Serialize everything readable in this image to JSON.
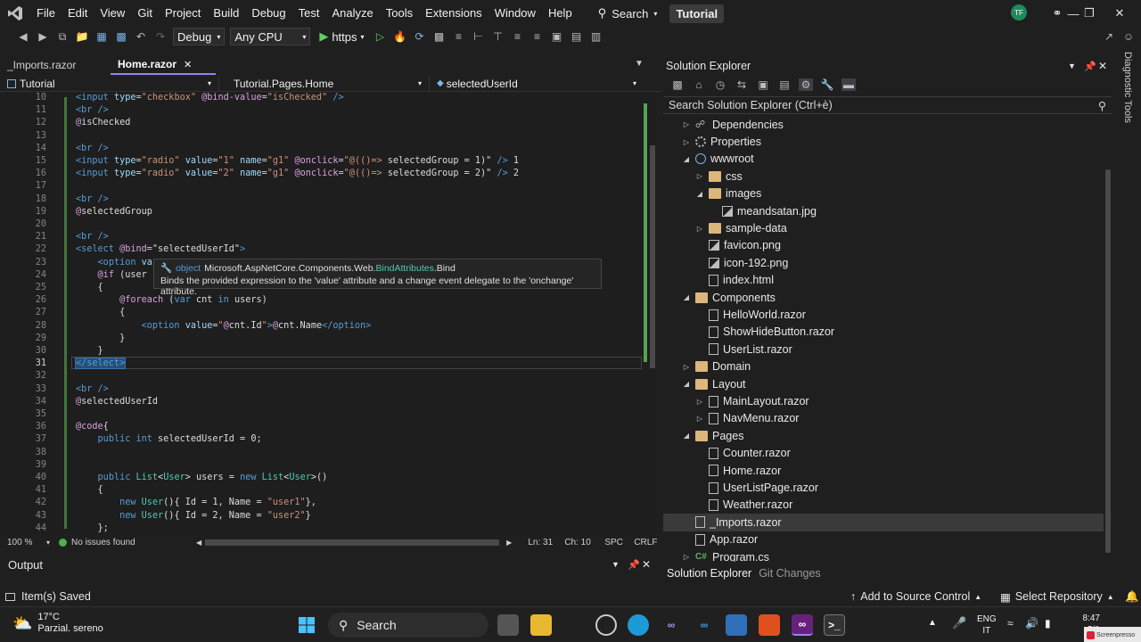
{
  "menu": {
    "items": [
      "File",
      "Edit",
      "View",
      "Git",
      "Project",
      "Build",
      "Debug",
      "Test",
      "Analyze",
      "Tools",
      "Extensions",
      "Window",
      "Help"
    ],
    "search_label": "Search",
    "solution_name": "Tutorial",
    "avatar_initials": "TF"
  },
  "toolbar": {
    "configuration": "Debug",
    "platform": "Any CPU",
    "run_target": "https"
  },
  "editor_tabs": [
    {
      "label": "_Imports.razor"
    },
    {
      "label": "Home.razor"
    }
  ],
  "navbar": {
    "project": "Tutorial",
    "type": "Tutorial.Pages.Home",
    "member": "selectedUserId"
  },
  "code_lines": [
    {
      "n": "10",
      "html": "<span class=\"t\">&lt;input</span> <span class=\"a\">type</span>=<span class=\"s\">\"checkbox\"</span> <span class=\"r\">@bind-value</span>=<span class=\"s\">\"isChecked\"</span> <span class=\"t\">/&gt;</span>"
    },
    {
      "n": "11",
      "html": "<span class=\"t\">&lt;br /&gt;</span>"
    },
    {
      "n": "12",
      "html": "<span class=\"r\">@</span><span class=\"w\">isChecked</span>"
    },
    {
      "n": "13",
      "html": ""
    },
    {
      "n": "14",
      "html": "<span class=\"t\">&lt;br /&gt;</span>"
    },
    {
      "n": "15",
      "html": "<span class=\"t\">&lt;input</span> <span class=\"a\">type</span>=<span class=\"s\">\"radio\"</span> <span class=\"a\">value</span>=<span class=\"s\">\"1\"</span> <span class=\"a\">name</span>=<span class=\"s\">\"g1\"</span> <span class=\"r\">@onclick</span>=<span class=\"s\">\"@(()=&gt;</span> <span class=\"w\">selectedGroup = 1)\"</span> <span class=\"t\">/&gt;</span> <span class=\"w\">1</span>"
    },
    {
      "n": "16",
      "html": "<span class=\"t\">&lt;input</span> <span class=\"a\">type</span>=<span class=\"s\">\"radio\"</span> <span class=\"a\">value</span>=<span class=\"s\">\"2\"</span> <span class=\"a\">name</span>=<span class=\"s\">\"g1\"</span> <span class=\"r\">@onclick</span>=<span class=\"s\">\"@(()=&gt;</span> <span class=\"w\">selectedGroup = 2)\"</span> <span class=\"t\">/&gt;</span> <span class=\"w\">2</span>"
    },
    {
      "n": "17",
      "html": ""
    },
    {
      "n": "18",
      "html": "<span class=\"t\">&lt;br /&gt;</span>"
    },
    {
      "n": "19",
      "html": "<span class=\"r\">@</span><span class=\"w\">selectedGroup</span>"
    },
    {
      "n": "20",
      "html": ""
    },
    {
      "n": "21",
      "html": "<span class=\"t\">&lt;br /&gt;</span>"
    },
    {
      "n": "22",
      "html": "<span class=\"t\">&lt;select</span> <span class=\"r\">@bind</span>=<span class=\"w\">\"selectedUserId\"</span><span class=\"t\">&gt;</span>"
    },
    {
      "n": "23",
      "html": "    <span class=\"t\">&lt;option</span> <span class=\"a\">va</span>"
    },
    {
      "n": "24",
      "html": "    <span class=\"r\">@if</span> <span class=\"w\">(user</span>"
    },
    {
      "n": "25",
      "html": "    <span class=\"w\">{</span>"
    },
    {
      "n": "26",
      "html": "        <span class=\"r\">@foreach</span> <span class=\"w\">(</span><span class=\"k\">var</span> <span class=\"w\">cnt</span> <span class=\"k\">in</span> <span class=\"w\">users)</span>"
    },
    {
      "n": "27",
      "html": "        <span class=\"w\">{</span>"
    },
    {
      "n": "28",
      "html": "            <span class=\"t\">&lt;option</span> <span class=\"a\">value</span>=<span class=\"s\">\"</span><span class=\"r\">@</span><span class=\"w\">cnt.Id</span><span class=\"s\">\"</span><span class=\"t\">&gt;</span><span class=\"r\">@</span><span class=\"w\">cnt.Name</span><span class=\"t\">&lt;/option&gt;</span>"
    },
    {
      "n": "29",
      "html": "        <span class=\"w\">}</span>"
    },
    {
      "n": "30",
      "html": "    <span class=\"w\">}</span>"
    },
    {
      "n": "31",
      "html": "<span class=\"hl\">&lt;/select&gt;</span>"
    },
    {
      "n": "32",
      "html": ""
    },
    {
      "n": "33",
      "html": "<span class=\"t\">&lt;br /&gt;</span>"
    },
    {
      "n": "34",
      "html": "<span class=\"r\">@</span><span class=\"w\">selectedUserId</span>"
    },
    {
      "n": "35",
      "html": ""
    },
    {
      "n": "36",
      "html": "<span class=\"r\">@code</span><span class=\"w\">{</span>"
    },
    {
      "n": "37",
      "html": "    <span class=\"k\">public</span> <span class=\"k\">int</span> <span class=\"w\">selectedUserId = 0;</span>"
    },
    {
      "n": "38",
      "html": ""
    },
    {
      "n": "39",
      "html": ""
    },
    {
      "n": "40",
      "html": "    <span class=\"k\">public</span> <span class=\"c\">List</span><span class=\"w\">&lt;</span><span class=\"c\">User</span><span class=\"w\">&gt; users = </span><span class=\"k\">new</span> <span class=\"c\">List</span><span class=\"w\">&lt;</span><span class=\"c\">User</span><span class=\"w\">&gt;()</span>"
    },
    {
      "n": "41",
      "html": "    <span class=\"w\">{</span>"
    },
    {
      "n": "42",
      "html": "        <span class=\"k\">new</span> <span class=\"c\">User</span><span class=\"w\">(){ Id = 1, Name = </span><span class=\"s\">\"user1\"</span><span class=\"w\">},</span>"
    },
    {
      "n": "43",
      "html": "        <span class=\"k\">new</span> <span class=\"c\">User</span><span class=\"w\">(){ Id = 2, Name = </span><span class=\"s\">\"user2\"</span><span class=\"w\">}</span>"
    },
    {
      "n": "44",
      "html": "    <span class=\"w\">};</span>"
    }
  ],
  "tooltip": {
    "kind": "object",
    "symbol_prefix": "Microsoft.AspNetCore.Components.Web.",
    "symbol_class": "BindAttributes",
    "symbol_member": ".Bind",
    "description": "Binds the provided expression to the 'value' attribute and a change event delegate to the 'onchange' attribute."
  },
  "editor_status": {
    "zoom": "100 %",
    "issues": "No issues found",
    "line": "Ln: 31",
    "column": "Ch: 10",
    "whitespace": "SPC",
    "line_ending": "CRLF"
  },
  "output": {
    "title": "Output"
  },
  "solution_explorer": {
    "title": "Solution Explorer",
    "search_placeholder": "Search Solution Explorer (Ctrl+è)",
    "tree": [
      {
        "label": "Dependencies",
        "depth": 1,
        "toggle": "collapsed",
        "icon": "dependencies-icon"
      },
      {
        "label": "Properties",
        "depth": 1,
        "toggle": "collapsed",
        "icon": "properties-icon"
      },
      {
        "label": "wwwroot",
        "depth": 1,
        "toggle": "expanded",
        "icon": "globe-icon"
      },
      {
        "label": "css",
        "depth": 2,
        "toggle": "collapsed",
        "icon": "folder-icon"
      },
      {
        "label": "images",
        "depth": 2,
        "toggle": "expanded",
        "icon": "folder-icon"
      },
      {
        "label": "meandsatan.jpg",
        "depth": 3,
        "toggle": "none",
        "icon": "image-file-icon"
      },
      {
        "label": "sample-data",
        "depth": 2,
        "toggle": "collapsed",
        "icon": "folder-icon"
      },
      {
        "label": "favicon.png",
        "depth": 2,
        "toggle": "none",
        "icon": "image-file-icon"
      },
      {
        "label": "icon-192.png",
        "depth": 2,
        "toggle": "none",
        "icon": "image-file-icon"
      },
      {
        "label": "index.html",
        "depth": 2,
        "toggle": "none",
        "icon": "html-file-icon"
      },
      {
        "label": "Components",
        "depth": 1,
        "toggle": "expanded",
        "icon": "folder-icon"
      },
      {
        "label": "HelloWorld.razor",
        "depth": 2,
        "toggle": "none",
        "icon": "razor-file-icon"
      },
      {
        "label": "ShowHideButton.razor",
        "depth": 2,
        "toggle": "none",
        "icon": "razor-file-icon"
      },
      {
        "label": "UserList.razor",
        "depth": 2,
        "toggle": "none",
        "icon": "razor-file-icon"
      },
      {
        "label": "Domain",
        "depth": 1,
        "toggle": "collapsed",
        "icon": "folder-icon"
      },
      {
        "label": "Layout",
        "depth": 1,
        "toggle": "expanded",
        "icon": "folder-icon"
      },
      {
        "label": "MainLayout.razor",
        "depth": 2,
        "toggle": "collapsed",
        "icon": "razor-file-icon"
      },
      {
        "label": "NavMenu.razor",
        "depth": 2,
        "toggle": "collapsed",
        "icon": "razor-file-icon"
      },
      {
        "label": "Pages",
        "depth": 1,
        "toggle": "expanded",
        "icon": "folder-icon"
      },
      {
        "label": "Counter.razor",
        "depth": 2,
        "toggle": "none",
        "icon": "razor-file-icon"
      },
      {
        "label": "Home.razor",
        "depth": 2,
        "toggle": "none",
        "icon": "razor-file-icon"
      },
      {
        "label": "UserListPage.razor",
        "depth": 2,
        "toggle": "none",
        "icon": "razor-file-icon"
      },
      {
        "label": "Weather.razor",
        "depth": 2,
        "toggle": "none",
        "icon": "razor-file-icon"
      },
      {
        "label": "_Imports.razor",
        "depth": 1,
        "toggle": "none",
        "icon": "razor-file-icon",
        "selected": true
      },
      {
        "label": "App.razor",
        "depth": 1,
        "toggle": "none",
        "icon": "razor-file-icon"
      },
      {
        "label": "Program.cs",
        "depth": 1,
        "toggle": "collapsed",
        "icon": "csharp-file-icon"
      }
    ],
    "bottom_tabs": [
      "Solution Explorer",
      "Git Changes"
    ],
    "diagnostic_tools": "Diagnostic Tools"
  },
  "status_bar": {
    "message": "Item(s) Saved",
    "source_control": "Add to Source Control",
    "repository": "Select Repository"
  },
  "taskbar": {
    "weather_temp": "17°C",
    "weather_desc": "Parzial. sereno",
    "search_label": "Search",
    "lang_top": "ENG",
    "lang_bottom": "IT",
    "time": "8:47",
    "date": "5/1",
    "watermark": "Screenpresso"
  },
  "colors": {
    "accent": "#9184ee",
    "tag": "#569cd6",
    "attribute": "#9cdcfe",
    "string": "#ce9178",
    "razor": "#c586c0",
    "class": "#4ec9b0",
    "change_bar": "#54a44e"
  }
}
